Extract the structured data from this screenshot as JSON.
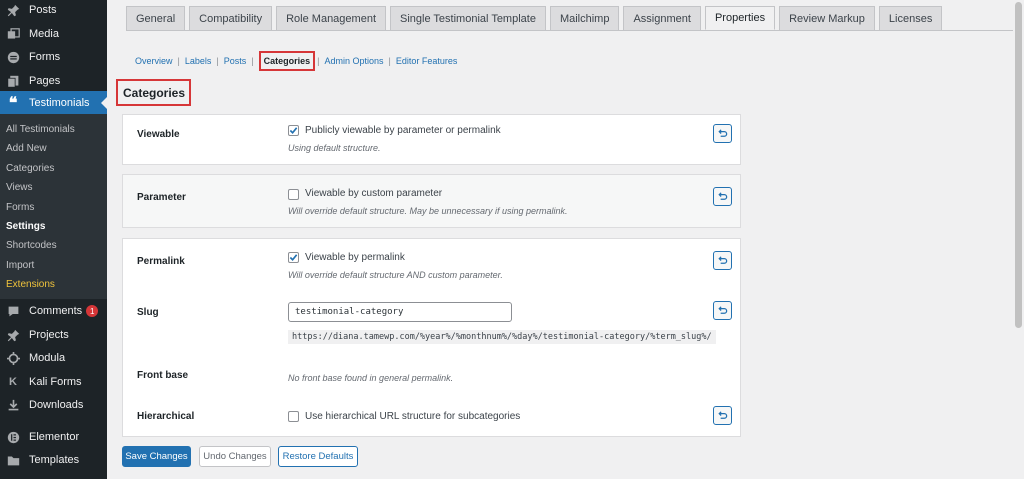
{
  "sidebar": {
    "top_items": [
      {
        "label": "Posts",
        "icon": "pushpin-icon"
      },
      {
        "label": "Media",
        "icon": "media-icon"
      },
      {
        "label": "Forms",
        "icon": "forms-icon"
      },
      {
        "label": "Pages",
        "icon": "pages-icon"
      },
      {
        "label": "Testimonials",
        "icon": "quote-icon"
      }
    ],
    "submenu": [
      "All Testimonials",
      "Add New",
      "Categories",
      "Views",
      "Forms",
      "Settings",
      "Shortcodes",
      "Import",
      "Extensions"
    ],
    "bottom_items": [
      {
        "label": "Comments",
        "icon": "comments-icon",
        "badge": "1"
      },
      {
        "label": "Projects",
        "icon": "pushpin-icon"
      },
      {
        "label": "Modula",
        "icon": "modula-icon"
      },
      {
        "label": "Kali Forms",
        "icon": "kali-icon"
      },
      {
        "label": "Downloads",
        "icon": "downloads-icon"
      },
      {
        "label": "Elementor",
        "icon": "elementor-icon"
      },
      {
        "label": "Templates",
        "icon": "folder-icon"
      }
    ]
  },
  "tabs": [
    "General",
    "Compatibility",
    "Role Management",
    "Single Testimonial Template",
    "Mailchimp",
    "Assignment",
    "Properties",
    "Review Markup",
    "Licenses"
  ],
  "subnav": {
    "links": [
      "Overview",
      "Labels",
      "Posts"
    ],
    "current": "Categories",
    "links_after": [
      "Admin Options",
      "Editor Features"
    ],
    "separator": "|"
  },
  "section_heading": "Categories",
  "viewable": {
    "label": "Viewable",
    "checkbox_label": "Publicly viewable by parameter or permalink",
    "checked": true,
    "hint": "Using default structure."
  },
  "parameter": {
    "label": "Parameter",
    "checkbox_label": "Viewable by custom parameter",
    "checked": false,
    "hint": "Will override default structure. May be unnecessary if using permalink."
  },
  "permalink": {
    "label": "Permalink",
    "checkbox_label": "Viewable by permalink",
    "checked": true,
    "hint": "Will override default structure AND custom parameter."
  },
  "slug": {
    "label": "Slug",
    "value": "testimonial-category",
    "url": "https://diana.tamewp.com/%year%/%monthnum%/%day%/testimonial-category/%term_slug%/"
  },
  "front_base": {
    "label": "Front base",
    "hint": "No front base found in general permalink."
  },
  "hierarchical": {
    "label": "Hierarchical",
    "checkbox_label": "Use hierarchical URL structure for subcategories",
    "checked": false
  },
  "buttons": {
    "save": "Save Changes",
    "undo": "Undo Changes",
    "restore": "Restore Defaults"
  },
  "colors": {
    "accent": "#2271b1",
    "highlight": "#d63638",
    "sidebar": "#1d2327"
  }
}
